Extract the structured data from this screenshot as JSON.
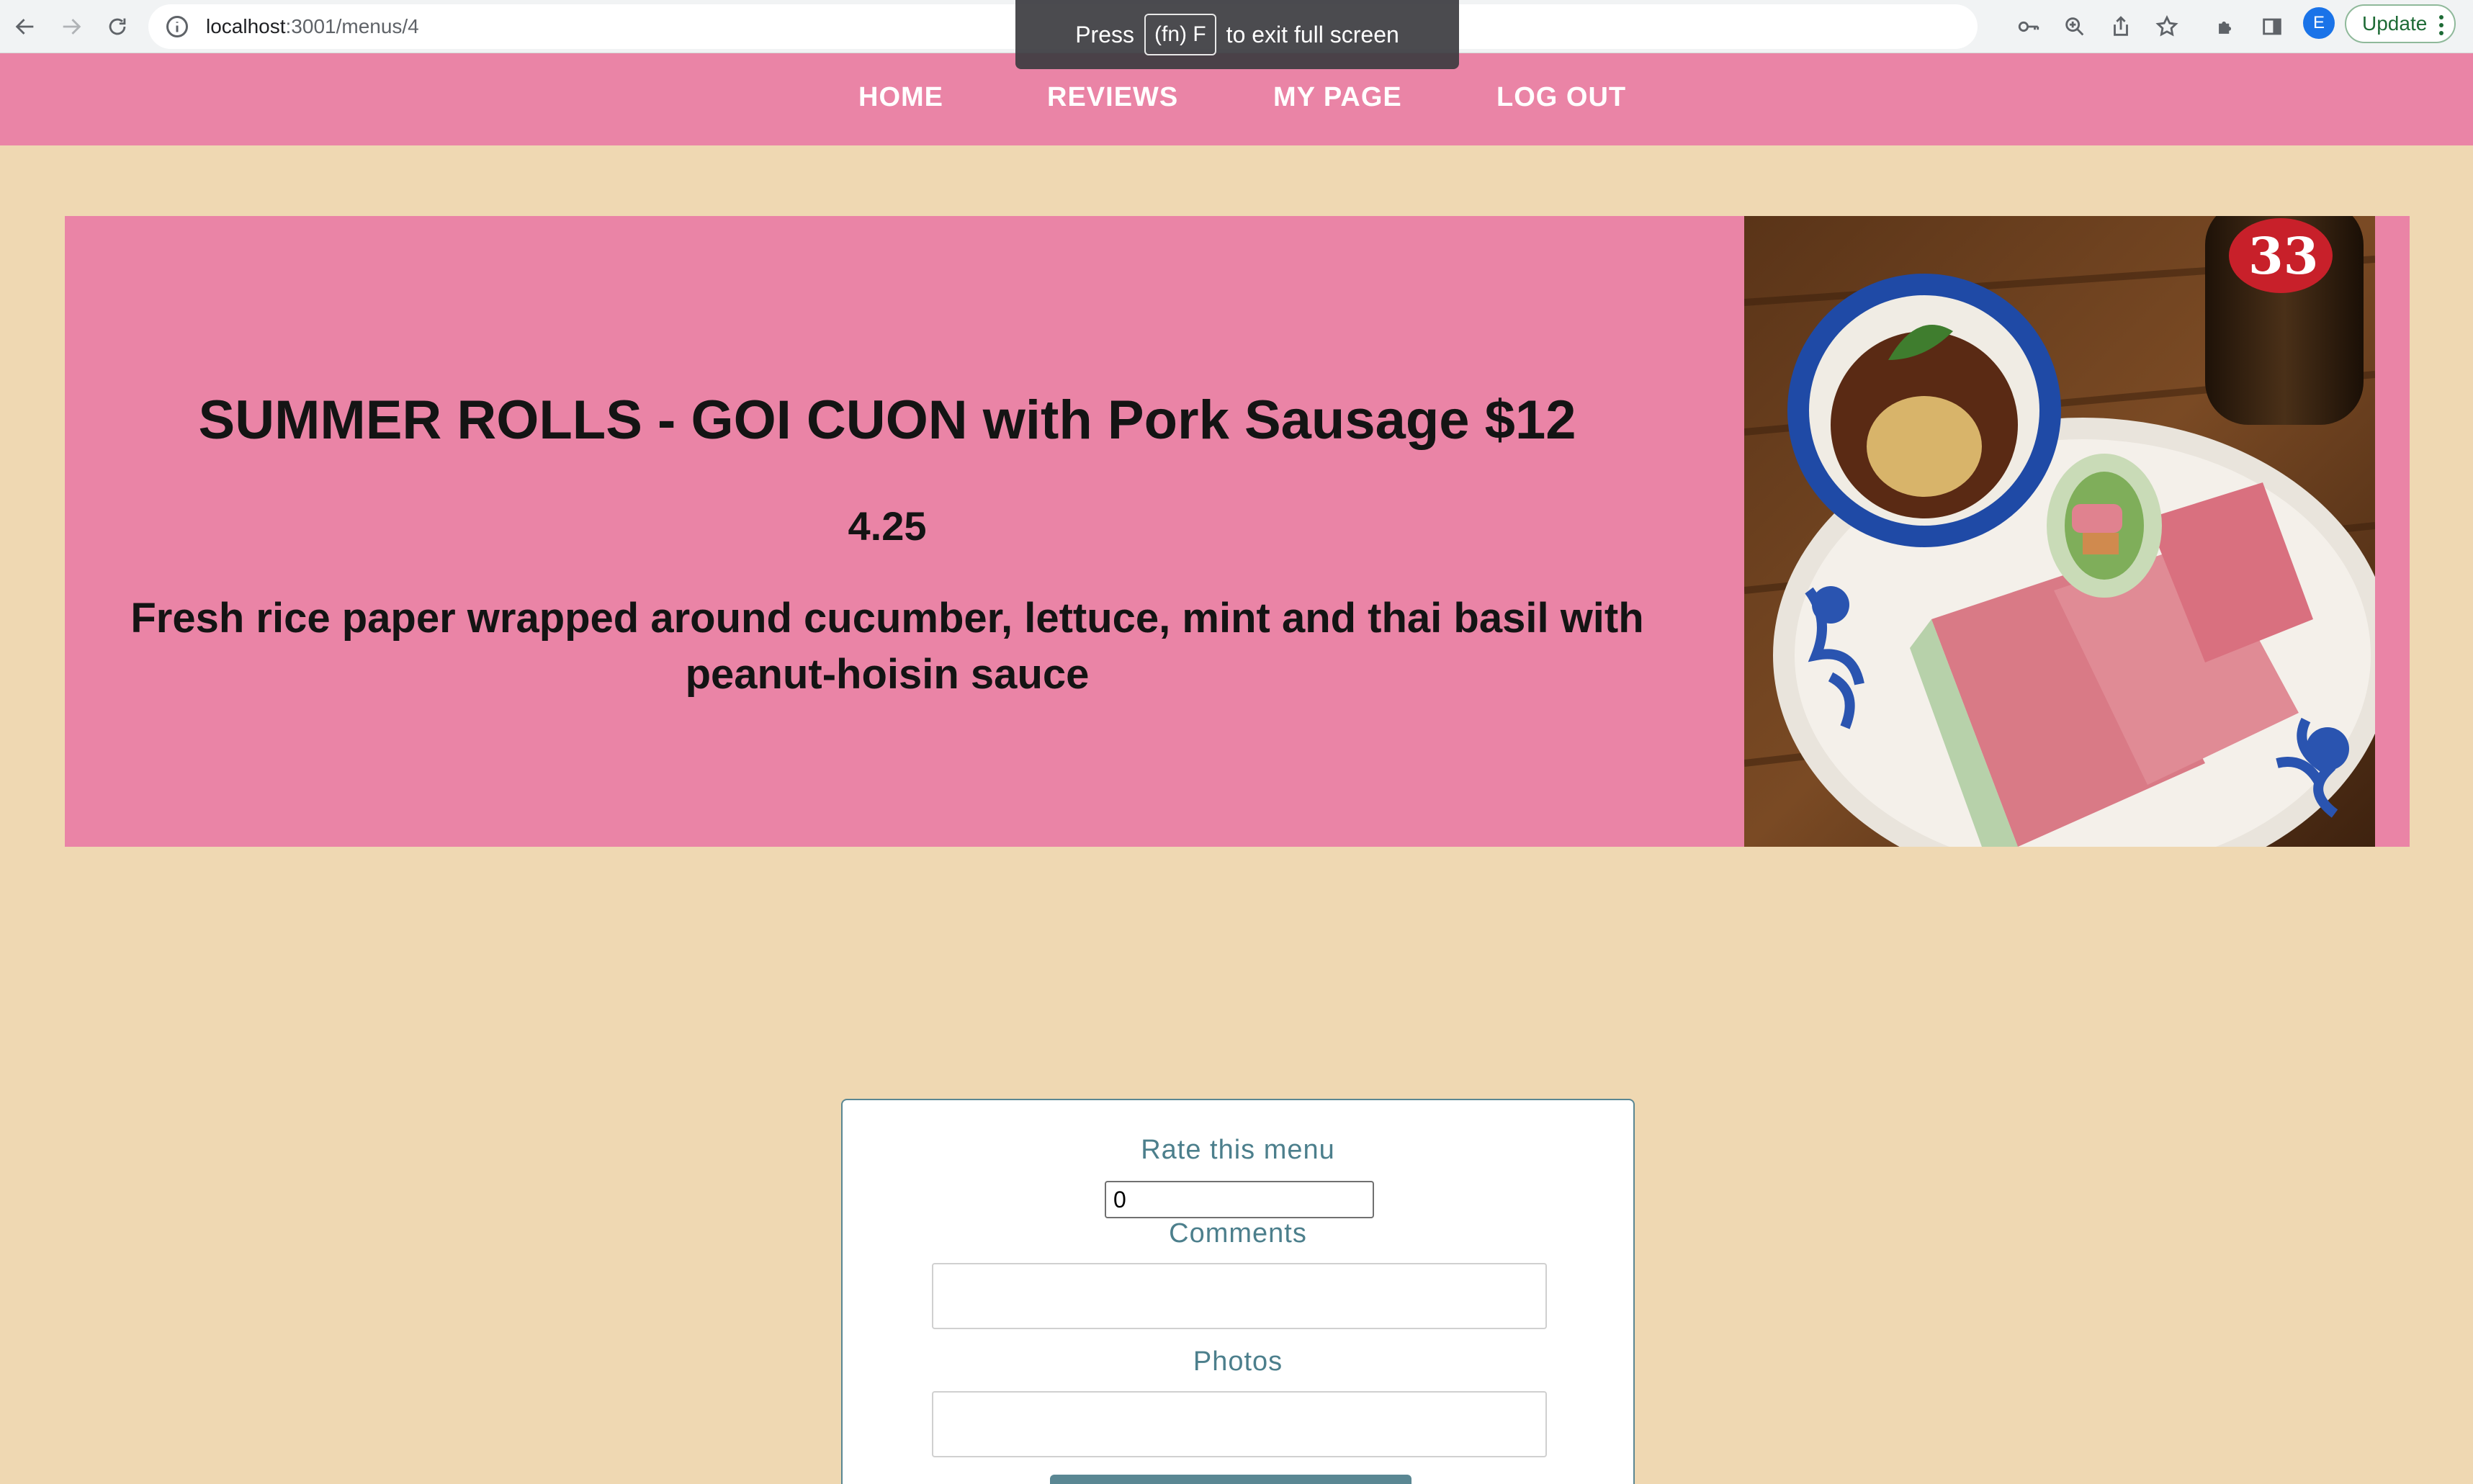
{
  "browser": {
    "url_host": "localhost",
    "url_path": ":3001/menus/4",
    "update_label": "Update",
    "profile_initial": "E",
    "icons": [
      "back-icon",
      "forward-icon",
      "reload-icon",
      "info-icon",
      "key-icon",
      "zoom-icon",
      "share-icon",
      "star-icon",
      "extensions-icon",
      "sidepanel-icon",
      "more-icon"
    ]
  },
  "fullscreen_toast": {
    "press": "Press",
    "key": "(fn) F",
    "suffix": "to exit full screen"
  },
  "nav": {
    "home": "HOME",
    "reviews": "REVIEWS",
    "my_page": "MY PAGE",
    "log_out": "LOG OUT"
  },
  "menu_item": {
    "title": "SUMMER ROLLS - GOI CUON with Pork Sausage $12",
    "rating": "4.25",
    "description": "Fresh rice paper wrapped around cucumber, lettuce, mint and thai basil with peanut-hoisin sauce"
  },
  "review_form": {
    "rate_label": "Rate this menu",
    "rate_value": "0",
    "comments_label": "Comments",
    "comments_value": "",
    "photos_label": "Photos",
    "photos_value": ""
  },
  "colors": {
    "accent_pink": "#ea84a6",
    "background": "#efd8b2",
    "form_teal": "#4c7f8c"
  }
}
